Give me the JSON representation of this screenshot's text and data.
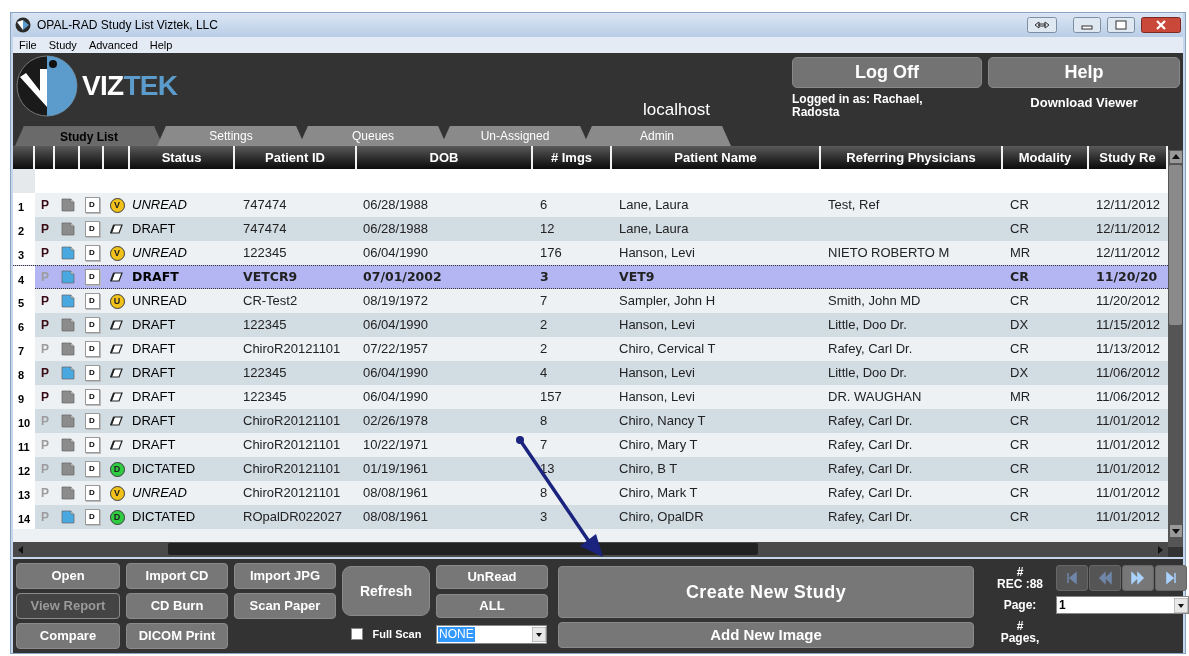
{
  "window": {
    "title": "OPAL-RAD Study List Viztek, LLC"
  },
  "menu": [
    "File",
    "Study",
    "Advanced",
    "Help"
  ],
  "logo": {
    "parts": [
      "VIZ",
      "TEK"
    ]
  },
  "server": "localhost",
  "header_buttons": [
    "Log Off",
    "Help"
  ],
  "logged_in": "Logged in as: Rachael, Radosta",
  "download_link": "Download Viewer",
  "tabs": [
    {
      "label": "Study List",
      "selected": true
    },
    {
      "label": "Settings",
      "selected": false
    },
    {
      "label": "Queues",
      "selected": false
    },
    {
      "label": "Un-Assigned",
      "selected": false
    },
    {
      "label": "Admin",
      "selected": false
    }
  ],
  "table": {
    "columns": [
      "Status",
      "Patient ID",
      "DOB",
      "# Imgs",
      "Patient Name",
      "Referring Physicians",
      "Modality",
      "Study Re"
    ],
    "rows": [
      {
        "num": "1",
        "p": "P",
        "p_enabled": true,
        "thumb_highlighted": false,
        "doc": "D",
        "status_icon": {
          "kind": "badge",
          "letter": "V",
          "color": "#f2c21b"
        },
        "status": "UNREAD",
        "italic": true,
        "selected": false,
        "patient_id": "747474",
        "dob": "06/28/1988",
        "imgs": "6",
        "patient_name": "Lane, Laura",
        "referring": "Test, Ref",
        "modality": "CR",
        "study_date": "12/11/2012"
      },
      {
        "num": "2",
        "p": "P",
        "p_enabled": true,
        "thumb_highlighted": false,
        "doc": "D",
        "status_icon": {
          "kind": "eraser"
        },
        "status": "DRAFT",
        "italic": false,
        "selected": false,
        "patient_id": "747474",
        "dob": "06/28/1988",
        "imgs": "12",
        "patient_name": "Lane, Laura",
        "modality": "CR",
        "study_date": "12/11/2012"
      },
      {
        "num": "3",
        "p": "P",
        "p_enabled": true,
        "thumb_highlighted": true,
        "doc": "D",
        "status_icon": {
          "kind": "badge",
          "letter": "V",
          "color": "#f2c21b"
        },
        "status": "UNREAD",
        "italic": true,
        "selected": false,
        "patient_id": "122345",
        "dob": "06/04/1990",
        "imgs": "176",
        "patient_name": "Hanson, Levi",
        "referring": "NIETO ROBERTO M",
        "modality": "MR",
        "study_date": "12/11/2012"
      },
      {
        "num": "4",
        "p": "P",
        "p_enabled": false,
        "thumb_highlighted": true,
        "doc": "D",
        "status_icon": {
          "kind": "eraser"
        },
        "status": "DRAFT",
        "italic": false,
        "selected": true,
        "patient_id": "VETCR9",
        "dob": "07/01/2002",
        "imgs": "3",
        "patient_name": "VET9",
        "modality": "CR",
        "study_date": "11/20/20"
      },
      {
        "num": "5",
        "p": "P",
        "p_enabled": true,
        "thumb_highlighted": true,
        "doc": "D",
        "status_icon": {
          "kind": "badge",
          "letter": "U",
          "color": "#f2c21b"
        },
        "status": "UNREAD",
        "italic": false,
        "selected": false,
        "patient_id": "CR-Test2",
        "dob": "08/19/1972",
        "imgs": "7",
        "patient_name": "Sampler, John H",
        "referring": "Smith, John MD",
        "modality": "CR",
        "study_date": "11/20/2012"
      },
      {
        "num": "6",
        "p": "P",
        "p_enabled": true,
        "thumb_highlighted": false,
        "doc": "D",
        "status_icon": {
          "kind": "eraser"
        },
        "status": "DRAFT",
        "italic": false,
        "selected": false,
        "patient_id": "122345",
        "dob": "06/04/1990",
        "imgs": "2",
        "patient_name": "Hanson, Levi",
        "referring": "Little, Doo Dr.",
        "modality": "DX",
        "study_date": "11/15/2012"
      },
      {
        "num": "7",
        "p": "P",
        "p_enabled": false,
        "thumb_highlighted": false,
        "doc": "D",
        "status_icon": {
          "kind": "eraser"
        },
        "status": "DRAFT",
        "italic": false,
        "selected": false,
        "patient_id": "ChiroR20121101",
        "dob": "07/22/1957",
        "imgs": "2",
        "patient_name": "Chiro, Cervical T",
        "referring": "Rafey, Carl Dr.",
        "modality": "CR",
        "study_date": "11/13/2012"
      },
      {
        "num": "8",
        "p": "P",
        "p_enabled": true,
        "thumb_highlighted": true,
        "doc": "D",
        "status_icon": {
          "kind": "eraser"
        },
        "status": "DRAFT",
        "italic": false,
        "selected": false,
        "patient_id": "122345",
        "dob": "06/04/1990",
        "imgs": "4",
        "patient_name": "Hanson, Levi",
        "referring": "Little, Doo Dr.",
        "modality": "DX",
        "study_date": "11/06/2012"
      },
      {
        "num": "9",
        "p": "P",
        "p_enabled": true,
        "thumb_highlighted": false,
        "doc": "D",
        "status_icon": {
          "kind": "eraser"
        },
        "status": "DRAFT",
        "italic": false,
        "selected": false,
        "patient_id": "122345",
        "dob": "06/04/1990",
        "imgs": "157",
        "patient_name": "Hanson, Levi",
        "referring": "DR. WAUGHAN",
        "modality": "MR",
        "study_date": "11/06/2012"
      },
      {
        "num": "10",
        "p": "P",
        "p_enabled": false,
        "thumb_highlighted": false,
        "doc": "D",
        "status_icon": {
          "kind": "eraser"
        },
        "status": "DRAFT",
        "italic": false,
        "selected": false,
        "patient_id": "ChiroR20121101",
        "dob": "02/26/1978",
        "imgs": "8",
        "patient_name": "Chiro, Nancy T",
        "referring": "Rafey, Carl Dr.",
        "modality": "CR",
        "study_date": "11/01/2012"
      },
      {
        "num": "11",
        "p": "P",
        "p_enabled": false,
        "thumb_highlighted": false,
        "doc": "D",
        "status_icon": {
          "kind": "eraser"
        },
        "status": "DRAFT",
        "italic": false,
        "selected": false,
        "patient_id": "ChiroR20121101",
        "dob": "10/22/1971",
        "imgs": "7",
        "patient_name": "Chiro, Mary T",
        "referring": "Rafey, Carl Dr.",
        "modality": "CR",
        "study_date": "11/01/2012"
      },
      {
        "num": "12",
        "p": "P",
        "p_enabled": false,
        "thumb_highlighted": false,
        "doc": "D",
        "status_icon": {
          "kind": "badge",
          "letter": "D",
          "color": "#2ecc40"
        },
        "status": "DICTATED",
        "italic": false,
        "selected": false,
        "patient_id": "ChiroR20121101",
        "dob": "01/19/1961",
        "imgs": "13",
        "patient_name": "Chiro, B T",
        "referring": "Rafey, Carl Dr.",
        "modality": "CR",
        "study_date": "11/01/2012"
      },
      {
        "num": "13",
        "p": "P",
        "p_enabled": false,
        "thumb_highlighted": false,
        "doc": "D",
        "status_icon": {
          "kind": "badge",
          "letter": "V",
          "color": "#f2c21b"
        },
        "status": "UNREAD",
        "italic": true,
        "selected": false,
        "patient_id": "ChiroR20121101",
        "dob": "08/08/1961",
        "imgs": "8",
        "patient_name": "Chiro, Mark T",
        "referring": "Rafey, Carl Dr.",
        "modality": "CR",
        "study_date": "11/01/2012"
      },
      {
        "num": "14",
        "p": "P",
        "p_enabled": false,
        "thumb_highlighted": true,
        "doc": "D",
        "status_icon": {
          "kind": "badge",
          "letter": "D",
          "color": "#2ecc40"
        },
        "status": "DICTATED",
        "italic": false,
        "selected": false,
        "patient_id": "ROpalDR022027",
        "dob": "08/08/1961",
        "imgs": "3",
        "patient_name": "Chiro, OpalDR",
        "referring": "Rafey, Carl Dr.",
        "modality": "CR",
        "study_date": "11/01/2012"
      }
    ]
  },
  "annotation_arrow": true,
  "actions": {
    "col1": [
      {
        "label": "Open",
        "disabled": false
      },
      {
        "label": "View Report",
        "disabled": true
      },
      {
        "label": "Compare",
        "disabled": false
      }
    ],
    "col2": [
      {
        "label": "Import CD",
        "disabled": false
      },
      {
        "label": "CD Burn",
        "disabled": false
      },
      {
        "label": "DICOM Print",
        "disabled": false
      }
    ],
    "col3": [
      {
        "label": "Import JPG",
        "disabled": false
      },
      {
        "label": "Scan Paper",
        "disabled": false
      }
    ],
    "refresh": "Refresh",
    "full_scan": {
      "label": "Full Scan",
      "checked": false
    },
    "filters": [
      "UnRead",
      "ALL"
    ],
    "filter_select": "NONE",
    "create": "Create New Study",
    "add_image": "Add New Image",
    "rec_hash": "#",
    "rec": "REC :88",
    "page_label": "Page:",
    "page_select": "1",
    "pages_hash": "#",
    "pages": "Pages,",
    "pager": [
      {
        "kind": "first",
        "disabled": true
      },
      {
        "kind": "prev",
        "disabled": true
      },
      {
        "kind": "next",
        "disabled": false
      },
      {
        "kind": "last",
        "disabled": false
      }
    ]
  }
}
